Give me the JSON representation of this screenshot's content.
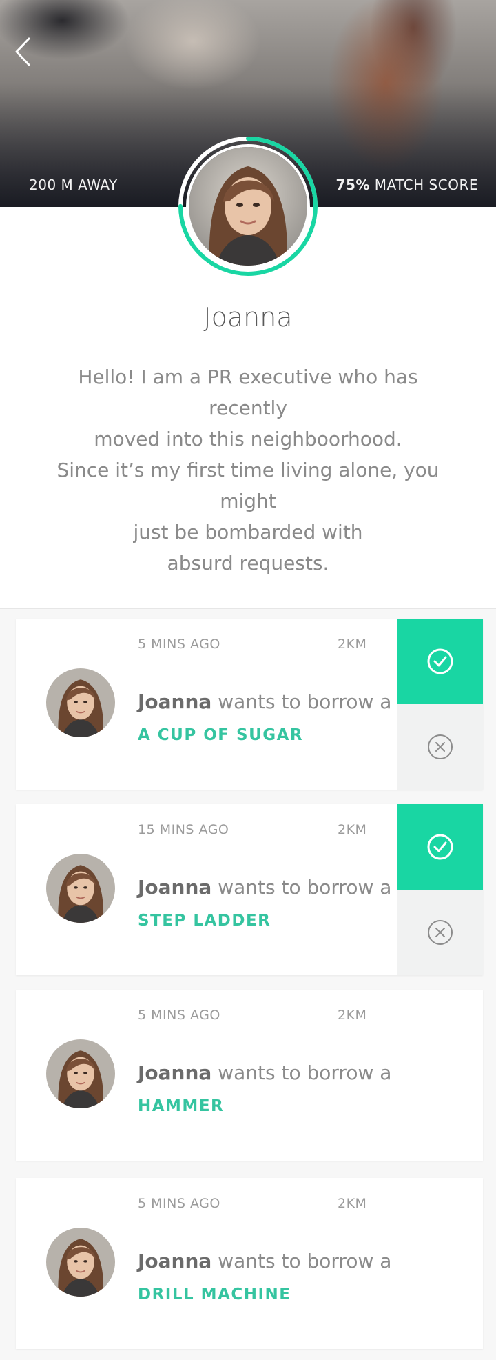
{
  "header": {
    "back_icon": "chevron-left-icon",
    "distance": "200 M AWAY",
    "match_percent": "75%",
    "match_label": " MATCH SCORE",
    "match_score": 0.75,
    "accent_color": "#19d6a3"
  },
  "profile": {
    "name": "Joanna",
    "bio_lines": [
      "Hello! I am a PR executive who has recently",
      "moved into this neighboorhood.",
      "Since it’s my first time living alone, you might",
      "just be bombarded with",
      "absurd requests."
    ]
  },
  "requests": [
    {
      "time": "5 MINS AGO",
      "distance": "2KM",
      "name": "Joanna",
      "text": " wants to borrow a",
      "item": "A CUP OF SUGAR",
      "actions": true
    },
    {
      "time": "15 MINS AGO",
      "distance": "2KM",
      "name": "Joanna",
      "text": " wants to borrow a",
      "item": "STEP LADDER",
      "actions": true
    },
    {
      "time": "5 MINS AGO",
      "distance": "2KM",
      "name": "Joanna",
      "text": " wants to borrow a",
      "item": "HAMMER",
      "actions": false
    },
    {
      "time": "5 MINS AGO",
      "distance": "2KM",
      "name": "Joanna",
      "text": " wants to borrow a",
      "item": "DRILL MACHINE",
      "actions": false
    }
  ]
}
